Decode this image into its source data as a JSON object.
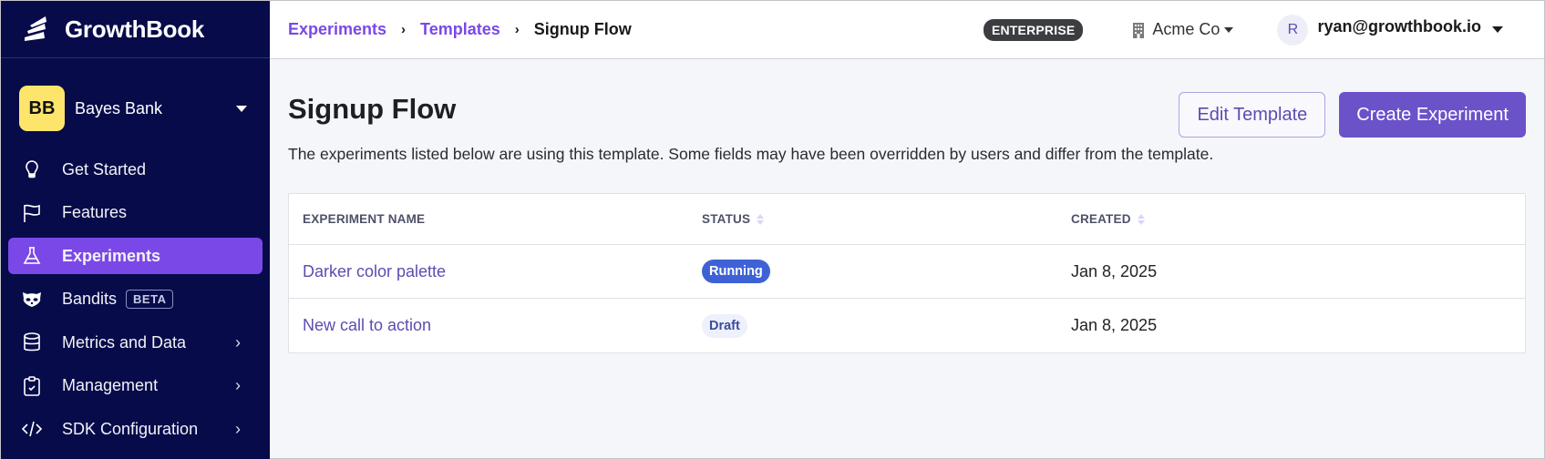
{
  "brand": {
    "name": "GrowthBook",
    "logo_icon": "growthbook-logo-icon"
  },
  "org": {
    "initials": "BB",
    "name": "Bayes Bank",
    "avatar_color": "#fde56b"
  },
  "sidebar": {
    "items": [
      {
        "label": "Get Started",
        "icon": "lightbulb-icon",
        "active": false,
        "has_submenu": false
      },
      {
        "label": "Features",
        "icon": "flag-icon",
        "active": false,
        "has_submenu": false
      },
      {
        "label": "Experiments",
        "icon": "flask-icon",
        "active": true,
        "has_submenu": false
      },
      {
        "label": "Bandits",
        "icon": "raccoon-icon",
        "active": false,
        "has_submenu": false,
        "badge": "BETA"
      },
      {
        "label": "Metrics and Data",
        "icon": "database-icon",
        "active": false,
        "has_submenu": true
      },
      {
        "label": "Management",
        "icon": "clipboard-check-icon",
        "active": false,
        "has_submenu": true
      },
      {
        "label": "SDK Configuration",
        "icon": "code-icon",
        "active": false,
        "has_submenu": true
      }
    ],
    "chevron": "›"
  },
  "topbar": {
    "breadcrumb": [
      {
        "label": "Experiments",
        "link": true
      },
      {
        "label": "Templates",
        "link": true
      },
      {
        "label": "Signup Flow",
        "link": false
      }
    ],
    "separator": "›",
    "plan_badge": "ENTERPRISE",
    "organization": "Acme Co",
    "user_initial": "R",
    "user_email": "ryan@growthbook.io"
  },
  "page": {
    "title": "Signup Flow",
    "description": "The experiments listed below are using this template. Some fields may have been overridden by users and differ from the template.",
    "edit_button": "Edit Template",
    "create_button": "Create Experiment"
  },
  "table": {
    "columns": [
      "EXPERIMENT NAME",
      "STATUS",
      "CREATED"
    ],
    "rows": [
      {
        "name": "Darker color palette",
        "status": "Running",
        "created": "Jan 8, 2025"
      },
      {
        "name": "New call to action",
        "status": "Draft",
        "created": "Jan 8, 2025"
      }
    ]
  },
  "colors": {
    "sidebar_bg": "#070b4a",
    "accent": "#7b48e8",
    "primary_button": "#6b52c9",
    "running": "#3e62d6",
    "draft_bg": "#eef0fb"
  }
}
